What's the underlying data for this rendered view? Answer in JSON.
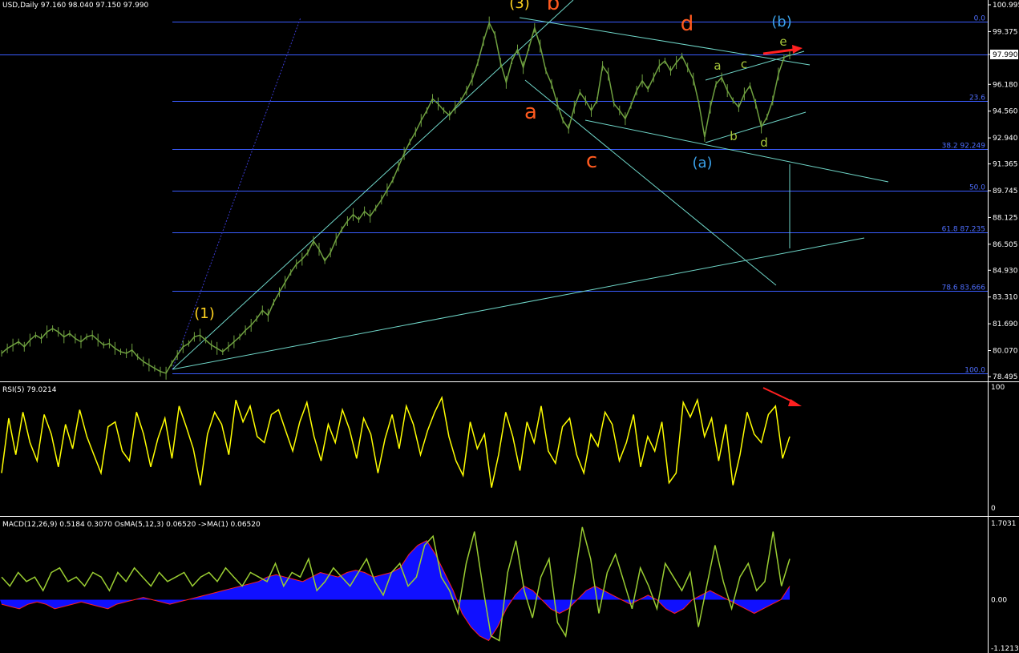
{
  "header": {
    "symbol_info": "USD,Daily  97.160 98.040 97.150 97.990",
    "rsi_info": "RSI(5) 79.0214",
    "macd_info": "MACD(12,26,9) 0.5184 0.3070  OsMA(5,12,3) 0.06520  ->MA(1) 0.06520"
  },
  "colors": {
    "background": "#000000",
    "price": "#6fa040",
    "fib": "#3a5cff",
    "trend": "#6fd6c8",
    "rsi": "#ffff00",
    "macd_line": "#9acd32",
    "signal": "#ff2020",
    "histogram": "#1010ff",
    "axis_text": "#ffffff",
    "wave_orange": "#ff5a1f",
    "wave_yellow": "#ffd21f",
    "wave_cyan": "#3aa0e8",
    "wave_green": "#a8c83a",
    "arrow": "#ff2020"
  },
  "chart_data": [
    {
      "type": "line",
      "name": "price",
      "y_ticks": [
        "100.995",
        "99.375",
        "97.990",
        "96.180",
        "94.560",
        "92.940",
        "91.365",
        "89.745",
        "88.125",
        "86.505",
        "84.930",
        "83.310",
        "81.690",
        "80.070",
        "78.495"
      ],
      "ylim": [
        78.495,
        100.995
      ],
      "current_price": "97.990",
      "fib_levels": [
        {
          "label": "0.0",
          "value": 100.0
        },
        {
          "label": "23.6",
          "value": 95.2
        },
        {
          "label": "38.2 92.249",
          "value": 92.249
        },
        {
          "label": "50.0",
          "value": 89.745
        },
        {
          "label": "61.8 87.235",
          "value": 87.235
        },
        {
          "label": "78.6 83.666",
          "value": 83.666
        },
        {
          "label": "100.0",
          "value": 78.7
        }
      ],
      "current_line": 97.99,
      "series": [
        {
          "values": [
            79.9,
            80.2,
            80.4,
            80.6,
            80.3,
            80.7,
            81.0,
            80.8,
            81.2,
            81.4,
            81.2,
            80.9,
            81.1,
            80.8,
            80.6,
            80.9,
            81.0,
            80.7,
            80.4,
            80.5,
            80.2,
            80.0,
            79.9,
            80.1,
            79.7,
            79.4,
            79.2,
            79.0,
            78.8,
            78.7,
            79.3,
            79.8,
            80.3,
            80.5,
            80.9,
            81.0,
            80.7,
            80.4,
            80.2,
            80.0,
            80.3,
            80.6,
            80.9,
            81.3,
            81.6,
            82.0,
            82.5,
            82.2,
            83.0,
            83.6,
            84.2,
            84.8,
            85.3,
            85.6,
            86.0,
            86.7,
            86.2,
            85.5,
            86.0,
            86.8,
            87.4,
            87.9,
            88.3,
            88.0,
            88.5,
            88.2,
            88.7,
            89.2,
            89.8,
            90.4,
            91.2,
            92.0,
            92.7,
            93.3,
            94.0,
            94.6,
            95.3,
            95.0,
            94.6,
            94.3,
            94.8,
            95.2,
            95.8,
            96.5,
            97.5,
            98.8,
            99.9,
            99.2,
            97.5,
            96.3,
            97.6,
            98.3,
            97.2,
            98.4,
            99.6,
            98.5,
            97.0,
            96.2,
            95.0,
            94.0,
            93.5,
            94.8,
            95.7,
            95.2,
            94.6,
            95.2,
            97.3,
            96.8,
            95.0,
            94.6,
            94.1,
            94.9,
            95.8,
            96.4,
            95.9,
            96.6,
            97.3,
            97.6,
            97.0,
            97.5,
            97.9,
            97.2,
            96.5,
            95.0,
            93.0,
            94.8,
            96.2,
            96.6,
            95.8,
            95.2,
            94.8,
            95.6,
            96.1,
            95.0,
            93.6,
            94.2,
            95.2,
            96.8,
            97.8,
            97.99
          ]
        }
      ],
      "wave_labels": [
        {
          "text": "(3)",
          "group": "yellow"
        },
        {
          "text": "b",
          "group": "orange"
        },
        {
          "text": "d",
          "group": "orange"
        },
        {
          "text": "(b)",
          "group": "cyan"
        },
        {
          "text": "e",
          "group": "green"
        },
        {
          "text": "a",
          "group": "green"
        },
        {
          "text": "c",
          "group": "green"
        },
        {
          "text": "a",
          "group": "orange"
        },
        {
          "text": "c",
          "group": "orange"
        },
        {
          "text": "b",
          "group": "green"
        },
        {
          "text": "d",
          "group": "green"
        },
        {
          "text": "(a)",
          "group": "cyan"
        },
        {
          "text": "(1)",
          "group": "yellow"
        }
      ]
    },
    {
      "type": "line",
      "name": "RSI(5)",
      "y_ticks": [
        "100",
        "0"
      ],
      "ylim": [
        0,
        100
      ],
      "series": [
        {
          "values": [
            30,
            75,
            45,
            80,
            55,
            40,
            78,
            62,
            35,
            70,
            50,
            82,
            60,
            45,
            30,
            68,
            72,
            48,
            40,
            80,
            62,
            35,
            58,
            75,
            42,
            85,
            68,
            50,
            20,
            62,
            80,
            70,
            45,
            90,
            72,
            85,
            60,
            55,
            78,
            82,
            65,
            48,
            72,
            88,
            60,
            40,
            70,
            55,
            82,
            66,
            42,
            75,
            62,
            30,
            58,
            78,
            50,
            85,
            70,
            45,
            65,
            80,
            92,
            60,
            40,
            28,
            72,
            50,
            62,
            18,
            45,
            80,
            60,
            32,
            72,
            55,
            85,
            48,
            38,
            68,
            75,
            45,
            30,
            62,
            52,
            80,
            70,
            40,
            55,
            78,
            35,
            60,
            48,
            72,
            22,
            30,
            88,
            76,
            90,
            60,
            75,
            40,
            70,
            20,
            45,
            80,
            62,
            55,
            78,
            85,
            42,
            60
          ]
        }
      ]
    },
    {
      "type": "line",
      "name": "MACD(12,26,9) OsMA(5,12,3)",
      "y_ticks": [
        "1.7031",
        "0.00",
        "-1.1213"
      ],
      "ylim": [
        -1.1213,
        1.7031
      ],
      "series": [
        {
          "name": "MACD",
          "values": [
            0.5,
            0.3,
            0.6,
            0.4,
            0.5,
            0.2,
            0.6,
            0.7,
            0.4,
            0.5,
            0.3,
            0.6,
            0.5,
            0.2,
            0.6,
            0.4,
            0.7,
            0.5,
            0.3,
            0.6,
            0.4,
            0.5,
            0.6,
            0.3,
            0.5,
            0.6,
            0.4,
            0.7,
            0.5,
            0.3,
            0.6,
            0.5,
            0.4,
            0.8,
            0.3,
            0.6,
            0.5,
            0.9,
            0.2,
            0.4,
            0.7,
            0.5,
            0.3,
            0.6,
            0.9,
            0.4,
            0.1,
            0.6,
            0.8,
            0.3,
            0.5,
            1.2,
            1.4,
            0.5,
            0.2,
            -0.3,
            0.8,
            1.5,
            0.3,
            -0.8,
            -0.9,
            0.6,
            1.3,
            0.2,
            -0.4,
            0.5,
            0.9,
            -0.5,
            -0.8,
            0.4,
            1.6,
            0.9,
            -0.3,
            0.6,
            1.0,
            0.4,
            -0.2,
            0.7,
            0.3,
            -0.2,
            0.8,
            0.5,
            0.2,
            0.6,
            -0.6,
            0.3,
            1.2,
            0.4,
            -0.2,
            0.5,
            0.8,
            0.2,
            0.4,
            1.5,
            0.3,
            0.9
          ]
        },
        {
          "name": "Signal",
          "values": [
            -0.1,
            -0.15,
            -0.2,
            -0.1,
            -0.05,
            -0.1,
            -0.2,
            -0.15,
            -0.1,
            -0.05,
            -0.1,
            -0.15,
            -0.2,
            -0.1,
            -0.05,
            0.0,
            0.05,
            0.0,
            -0.05,
            -0.1,
            -0.05,
            0.0,
            0.05,
            0.1,
            0.15,
            0.2,
            0.25,
            0.3,
            0.35,
            0.4,
            0.5,
            0.55,
            0.5,
            0.45,
            0.4,
            0.5,
            0.6,
            0.55,
            0.5,
            0.6,
            0.65,
            0.6,
            0.5,
            0.55,
            0.6,
            0.7,
            1.0,
            1.2,
            1.3,
            1.0,
            0.6,
            0.2,
            -0.3,
            -0.6,
            -0.8,
            -0.9,
            -0.6,
            -0.2,
            0.1,
            0.3,
            0.2,
            0.0,
            -0.2,
            -0.3,
            -0.2,
            0.0,
            0.2,
            0.3,
            0.2,
            0.1,
            0.0,
            -0.1,
            0.0,
            0.1,
            0.0,
            -0.2,
            -0.3,
            -0.2,
            0.0,
            0.1,
            0.2,
            0.1,
            0.0,
            -0.1,
            -0.2,
            -0.3,
            -0.2,
            -0.1,
            0.0,
            0.3
          ]
        },
        {
          "name": "OsMA",
          "values": [
            -0.1,
            -0.15,
            -0.2,
            -0.1,
            -0.05,
            -0.1,
            -0.2,
            -0.15,
            -0.1,
            -0.05,
            -0.1,
            -0.15,
            -0.2,
            -0.1,
            -0.05,
            0.0,
            0.05,
            0.0,
            -0.05,
            -0.1,
            -0.05,
            0.0,
            0.05,
            0.1,
            0.15,
            0.2,
            0.25,
            0.3,
            0.35,
            0.4,
            0.5,
            0.55,
            0.5,
            0.45,
            0.4,
            0.5,
            0.6,
            0.55,
            0.5,
            0.6,
            0.65,
            0.6,
            0.5,
            0.55,
            0.6,
            0.7,
            1.0,
            1.2,
            1.3,
            1.0,
            0.6,
            0.2,
            -0.3,
            -0.6,
            -0.8,
            -0.9,
            -0.6,
            -0.2,
            0.1,
            0.3,
            0.2,
            0.0,
            -0.2,
            -0.3,
            -0.2,
            0.0,
            0.2,
            0.3,
            0.2,
            0.1,
            0.0,
            -0.1,
            0.0,
            0.1,
            0.0,
            -0.2,
            -0.3,
            -0.2,
            0.0,
            0.1,
            0.2,
            0.1,
            0.0,
            -0.1,
            -0.2,
            -0.3,
            -0.2,
            -0.1,
            0.0,
            0.3
          ]
        }
      ]
    }
  ]
}
